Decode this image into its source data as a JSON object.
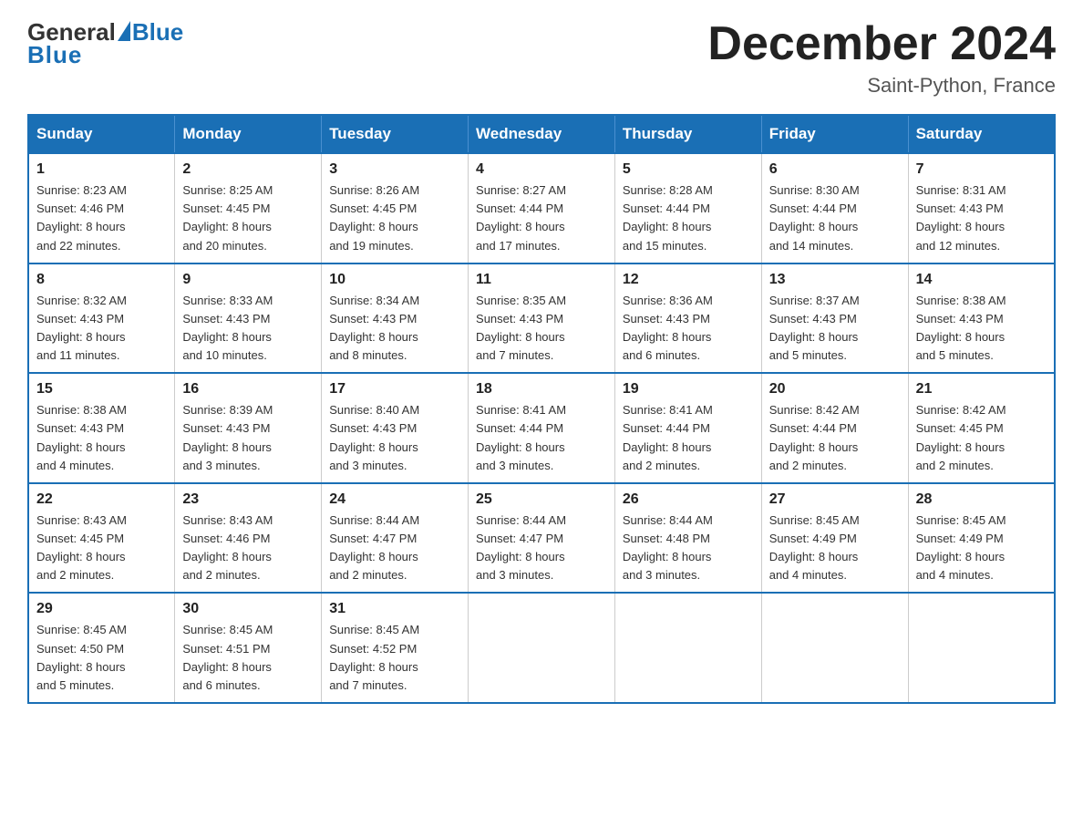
{
  "header": {
    "logo_general": "General",
    "logo_blue": "Blue",
    "month_title": "December 2024",
    "location": "Saint-Python, France"
  },
  "weekdays": [
    "Sunday",
    "Monday",
    "Tuesday",
    "Wednesday",
    "Thursday",
    "Friday",
    "Saturday"
  ],
  "weeks": [
    [
      {
        "day": "1",
        "sunrise": "8:23 AM",
        "sunset": "4:46 PM",
        "daylight": "8 hours and 22 minutes."
      },
      {
        "day": "2",
        "sunrise": "8:25 AM",
        "sunset": "4:45 PM",
        "daylight": "8 hours and 20 minutes."
      },
      {
        "day": "3",
        "sunrise": "8:26 AM",
        "sunset": "4:45 PM",
        "daylight": "8 hours and 19 minutes."
      },
      {
        "day": "4",
        "sunrise": "8:27 AM",
        "sunset": "4:44 PM",
        "daylight": "8 hours and 17 minutes."
      },
      {
        "day": "5",
        "sunrise": "8:28 AM",
        "sunset": "4:44 PM",
        "daylight": "8 hours and 15 minutes."
      },
      {
        "day": "6",
        "sunrise": "8:30 AM",
        "sunset": "4:44 PM",
        "daylight": "8 hours and 14 minutes."
      },
      {
        "day": "7",
        "sunrise": "8:31 AM",
        "sunset": "4:43 PM",
        "daylight": "8 hours and 12 minutes."
      }
    ],
    [
      {
        "day": "8",
        "sunrise": "8:32 AM",
        "sunset": "4:43 PM",
        "daylight": "8 hours and 11 minutes."
      },
      {
        "day": "9",
        "sunrise": "8:33 AM",
        "sunset": "4:43 PM",
        "daylight": "8 hours and 10 minutes."
      },
      {
        "day": "10",
        "sunrise": "8:34 AM",
        "sunset": "4:43 PM",
        "daylight": "8 hours and 8 minutes."
      },
      {
        "day": "11",
        "sunrise": "8:35 AM",
        "sunset": "4:43 PM",
        "daylight": "8 hours and 7 minutes."
      },
      {
        "day": "12",
        "sunrise": "8:36 AM",
        "sunset": "4:43 PM",
        "daylight": "8 hours and 6 minutes."
      },
      {
        "day": "13",
        "sunrise": "8:37 AM",
        "sunset": "4:43 PM",
        "daylight": "8 hours and 5 minutes."
      },
      {
        "day": "14",
        "sunrise": "8:38 AM",
        "sunset": "4:43 PM",
        "daylight": "8 hours and 5 minutes."
      }
    ],
    [
      {
        "day": "15",
        "sunrise": "8:38 AM",
        "sunset": "4:43 PM",
        "daylight": "8 hours and 4 minutes."
      },
      {
        "day": "16",
        "sunrise": "8:39 AM",
        "sunset": "4:43 PM",
        "daylight": "8 hours and 3 minutes."
      },
      {
        "day": "17",
        "sunrise": "8:40 AM",
        "sunset": "4:43 PM",
        "daylight": "8 hours and 3 minutes."
      },
      {
        "day": "18",
        "sunrise": "8:41 AM",
        "sunset": "4:44 PM",
        "daylight": "8 hours and 3 minutes."
      },
      {
        "day": "19",
        "sunrise": "8:41 AM",
        "sunset": "4:44 PM",
        "daylight": "8 hours and 2 minutes."
      },
      {
        "day": "20",
        "sunrise": "8:42 AM",
        "sunset": "4:44 PM",
        "daylight": "8 hours and 2 minutes."
      },
      {
        "day": "21",
        "sunrise": "8:42 AM",
        "sunset": "4:45 PM",
        "daylight": "8 hours and 2 minutes."
      }
    ],
    [
      {
        "day": "22",
        "sunrise": "8:43 AM",
        "sunset": "4:45 PM",
        "daylight": "8 hours and 2 minutes."
      },
      {
        "day": "23",
        "sunrise": "8:43 AM",
        "sunset": "4:46 PM",
        "daylight": "8 hours and 2 minutes."
      },
      {
        "day": "24",
        "sunrise": "8:44 AM",
        "sunset": "4:47 PM",
        "daylight": "8 hours and 2 minutes."
      },
      {
        "day": "25",
        "sunrise": "8:44 AM",
        "sunset": "4:47 PM",
        "daylight": "8 hours and 3 minutes."
      },
      {
        "day": "26",
        "sunrise": "8:44 AM",
        "sunset": "4:48 PM",
        "daylight": "8 hours and 3 minutes."
      },
      {
        "day": "27",
        "sunrise": "8:45 AM",
        "sunset": "4:49 PM",
        "daylight": "8 hours and 4 minutes."
      },
      {
        "day": "28",
        "sunrise": "8:45 AM",
        "sunset": "4:49 PM",
        "daylight": "8 hours and 4 minutes."
      }
    ],
    [
      {
        "day": "29",
        "sunrise": "8:45 AM",
        "sunset": "4:50 PM",
        "daylight": "8 hours and 5 minutes."
      },
      {
        "day": "30",
        "sunrise": "8:45 AM",
        "sunset": "4:51 PM",
        "daylight": "8 hours and 6 minutes."
      },
      {
        "day": "31",
        "sunrise": "8:45 AM",
        "sunset": "4:52 PM",
        "daylight": "8 hours and 7 minutes."
      },
      null,
      null,
      null,
      null
    ]
  ],
  "labels": {
    "sunrise": "Sunrise:",
    "sunset": "Sunset:",
    "daylight": "Daylight:"
  }
}
